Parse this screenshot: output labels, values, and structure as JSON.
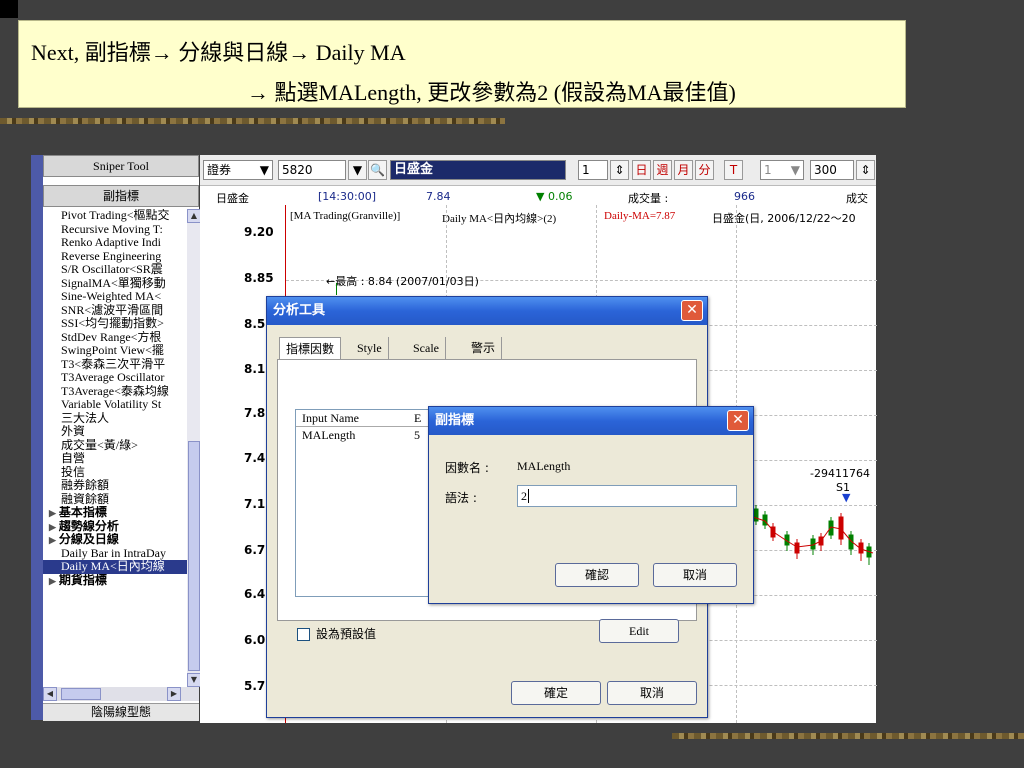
{
  "banner": {
    "line1": "Next, 副指標→ 分線與日線→ Daily MA",
    "line2": "→ 點選MALength, 更改參數為2 (假設為MA最佳值)"
  },
  "sidebar": {
    "title": "Sniper Tool",
    "subtitle": "副指標",
    "items": [
      "Pivot Trading<樞點交",
      "Recursive Moving T:",
      "Renko Adaptive Indi",
      "Reverse Engineering",
      "S/R Oscillator<SR震",
      "SignalMA<單獨移動",
      "Sine-Weighted MA<",
      "SNR<濾波平滑區間",
      "SSI<均勻擺動指數>",
      "StdDev Range<方根",
      "SwingPoint View<擺",
      "T3<泰森三次平滑平",
      "T3Average Oscillator",
      "T3Average<泰森均線",
      "Variable Volatility St",
      "三大法人",
      "外資",
      "成交量<黃/綠>",
      "自營",
      "投信",
      "融券餘額",
      "融資餘額"
    ],
    "groups": [
      "基本指標",
      "趨勢線分析",
      "分線及日線"
    ],
    "sub_items": [
      "Daily Bar in IntraDay",
      "Daily MA<日內均線"
    ],
    "group_last": "期貨指標",
    "footer": "陰陽線型態"
  },
  "toolbar": {
    "market": "證券",
    "code": "5820",
    "name": "日盛金",
    "interval": "1",
    "btn_day": "日",
    "btn_week": "週",
    "btn_month": "月",
    "btn_min": "分",
    "btn_t": "T",
    "num1": "1",
    "count": "300"
  },
  "quote": {
    "name": "日盛金",
    "time": "[14:30:00]",
    "price": "7.84",
    "change": "▼ 0.06",
    "vol_label": "成交量 :",
    "vol": "966",
    "cut": "成交"
  },
  "legend": {
    "study": "[MA Trading(Granville)]",
    "ma_name": "Daily MA<日內均線>(2)",
    "ma_value": "Daily-MA=7.87",
    "range": "日盛金(日, 2006/12/22～20"
  },
  "chart_data": {
    "type": "candlestick",
    "y_ticks": [
      "9.20",
      "8.85",
      "8.5",
      "8.1",
      "7.8",
      "7.4",
      "7.1",
      "6.7",
      "6.4",
      "6.0",
      "5.7"
    ],
    "annotation_high": "最高 : 8.84 (2007/01/03日)",
    "annotation_value": "-29411764",
    "annotation_signal": "S1",
    "ma_color": "#cc0000",
    "up_color": "#008000",
    "down_color": "#cc0000"
  },
  "dialog_main": {
    "title": "分析工具",
    "tabs": [
      "指標因數",
      "Style",
      "Scale",
      "警示"
    ],
    "col_input_name": "Input Name",
    "col_expr": "E",
    "row_name": "MALength",
    "row_value": "5",
    "default_label": "設為預設值",
    "edit": "Edit",
    "ok": "確定",
    "cancel": "取消"
  },
  "dialog_sub": {
    "title": "副指標",
    "param_label": "因數名 :",
    "param_value": "MALength",
    "syntax_label": "語法 :",
    "syntax_value": "2",
    "ok": "確認",
    "cancel": "取消"
  }
}
